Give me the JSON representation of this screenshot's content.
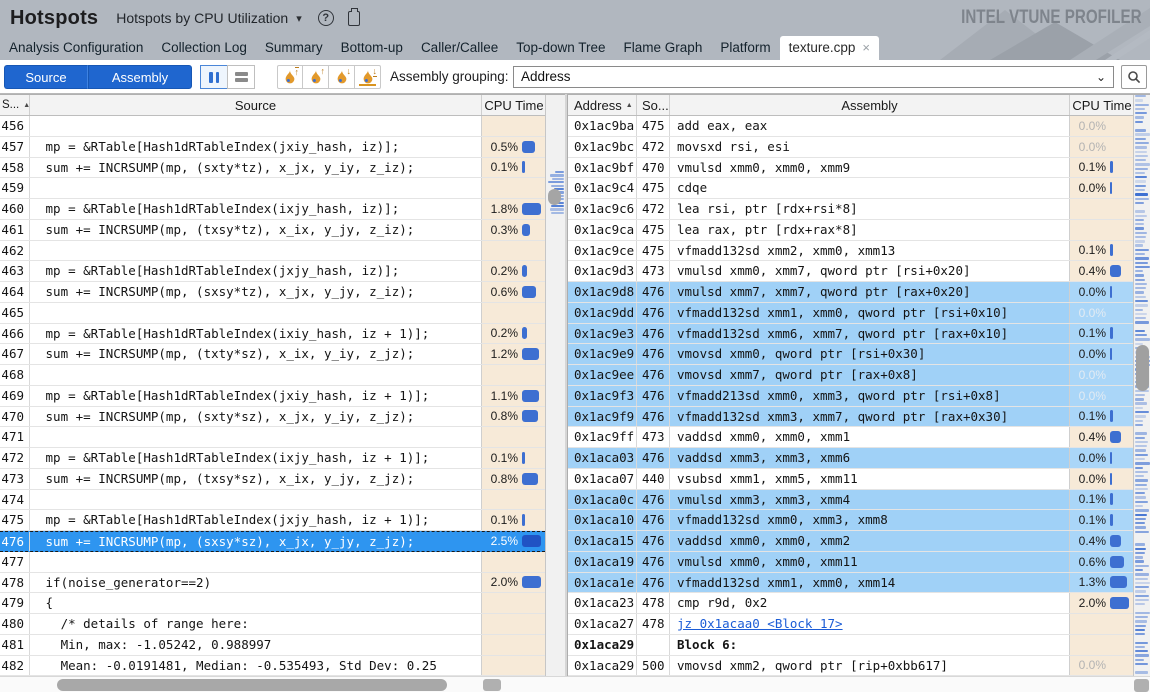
{
  "banner": {
    "title": "Hotspots",
    "subtitle": "Hotspots by CPU Utilization",
    "logo": "INTEL VTUNE PROFILER"
  },
  "tabs": [
    {
      "label": "Analysis Configuration"
    },
    {
      "label": "Collection Log"
    },
    {
      "label": "Summary"
    },
    {
      "label": "Bottom-up"
    },
    {
      "label": "Caller/Callee"
    },
    {
      "label": "Top-down Tree"
    },
    {
      "label": "Flame Graph"
    },
    {
      "label": "Platform"
    },
    {
      "label": "texture.cpp",
      "active": true,
      "closable": true
    }
  ],
  "toolbar": {
    "source_label": "Source",
    "assembly_label": "Assembly",
    "grouping_label": "Assembly grouping:",
    "grouping_value": "Address",
    "flame_buttons": [
      {
        "arrow": "↑",
        "bar": "top"
      },
      {
        "arrow": "↑",
        "bar": "none"
      },
      {
        "arrow": "↓",
        "bar": "none"
      },
      {
        "arrow": "↓",
        "bar": "bottom"
      }
    ]
  },
  "icons": {
    "dropdown_caret": "▾",
    "sort_asc": "▲",
    "close_x": "×",
    "help": "?"
  },
  "colors": {
    "accent_blue": "#1f66cf",
    "selection_blue": "#2e95f0",
    "asm_highlight": "#a0d1f7",
    "cpu_cell_bg": "#f7ead8",
    "cpu_bar_blue": "#3d6fd1",
    "flame_orange": "#e2992b",
    "banner_gray": "#b1b7bf"
  },
  "source_panel": {
    "columns": [
      "S...",
      "Source",
      "CPU Time"
    ],
    "rows": [
      {
        "n": 456,
        "code": "",
        "cpu": ""
      },
      {
        "n": 457,
        "code": " mp = &RTable[Hash1dRTableIndex(jxiy_hash, iz)];",
        "cpu": "0.5%",
        "pct": 0.5
      },
      {
        "n": 458,
        "code": " sum += INCRSUMP(mp, (sxty*tz), x_jx, y_iy, z_iz);",
        "cpu": "0.1%",
        "pct": 0.1
      },
      {
        "n": 459,
        "code": "",
        "cpu": ""
      },
      {
        "n": 460,
        "code": " mp = &RTable[Hash1dRTableIndex(ixjy_hash, iz)];",
        "cpu": "1.8%",
        "pct": 1.8
      },
      {
        "n": 461,
        "code": " sum += INCRSUMP(mp, (txsy*tz), x_ix, y_jy, z_iz);",
        "cpu": "0.3%",
        "pct": 0.3
      },
      {
        "n": 462,
        "code": "",
        "cpu": ""
      },
      {
        "n": 463,
        "code": " mp = &RTable[Hash1dRTableIndex(jxjy_hash, iz)];",
        "cpu": "0.2%",
        "pct": 0.2
      },
      {
        "n": 464,
        "code": " sum += INCRSUMP(mp, (sxsy*tz), x_jx, y_jy, z_iz);",
        "cpu": "0.6%",
        "pct": 0.6
      },
      {
        "n": 465,
        "code": "",
        "cpu": ""
      },
      {
        "n": 466,
        "code": " mp = &RTable[Hash1dRTableIndex(ixiy_hash, iz + 1)];",
        "cpu": "0.2%",
        "pct": 0.2
      },
      {
        "n": 467,
        "code": " sum += INCRSUMP(mp, (txty*sz), x_ix, y_iy, z_jz);",
        "cpu": "1.2%",
        "pct": 1.2
      },
      {
        "n": 468,
        "code": "",
        "cpu": ""
      },
      {
        "n": 469,
        "code": " mp = &RTable[Hash1dRTableIndex(jxiy_hash, iz + 1)];",
        "cpu": "1.1%",
        "pct": 1.1
      },
      {
        "n": 470,
        "code": " sum += INCRSUMP(mp, (sxty*sz), x_jx, y_iy, z_jz);",
        "cpu": "0.8%",
        "pct": 0.8
      },
      {
        "n": 471,
        "code": "",
        "cpu": ""
      },
      {
        "n": 472,
        "code": " mp = &RTable[Hash1dRTableIndex(ixjy_hash, iz + 1)];",
        "cpu": "0.1%",
        "pct": 0.1
      },
      {
        "n": 473,
        "code": " sum += INCRSUMP(mp, (txsy*sz), x_ix, y_jy, z_jz);",
        "cpu": "0.8%",
        "pct": 0.8
      },
      {
        "n": 474,
        "code": "",
        "cpu": ""
      },
      {
        "n": 475,
        "code": " mp = &RTable[Hash1dRTableIndex(jxjy_hash, iz + 1)];",
        "cpu": "0.1%",
        "pct": 0.1
      },
      {
        "n": 476,
        "code": " sum += INCRSUMP(mp, (sxsy*sz), x_jx, y_jy, z_jz);",
        "cpu": "2.5%",
        "pct": 2.5,
        "selected": true
      },
      {
        "n": 477,
        "code": "",
        "cpu": ""
      },
      {
        "n": 478,
        "code": " if(noise_generator==2)",
        "cpu": "2.0%",
        "pct": 2.0
      },
      {
        "n": 479,
        "code": " {",
        "cpu": ""
      },
      {
        "n": 480,
        "code": "   /* details of range here:",
        "cpu": ""
      },
      {
        "n": 481,
        "code": "   Min, max: -1.05242, 0.988997",
        "cpu": ""
      },
      {
        "n": 482,
        "code": "   Mean: -0.0191481, Median: -0.535493, Std Dev: 0.25",
        "cpu": ""
      }
    ]
  },
  "assembly_panel": {
    "columns": [
      "Address",
      "So...",
      "Assembly",
      "CPU Time"
    ],
    "rows": [
      {
        "addr": "0x1ac9ba",
        "line": "475",
        "text": "add eax, eax",
        "cpu": "0.0%",
        "gray": true
      },
      {
        "addr": "0x1ac9bc",
        "line": "472",
        "text": "movsxd rsi, esi",
        "cpu": "0.0%",
        "gray": true
      },
      {
        "addr": "0x1ac9bf",
        "line": "470",
        "text": "vmulsd xmm0, xmm0, xmm9",
        "cpu": "0.1%",
        "pct": 0.1
      },
      {
        "addr": "0x1ac9c4",
        "line": "475",
        "text": "cdqe",
        "cpu": "0.0%",
        "pct": 0
      },
      {
        "addr": "0x1ac9c6",
        "line": "472",
        "text": "lea rsi, ptr [rdx+rsi*8]",
        "cpu": ""
      },
      {
        "addr": "0x1ac9ca",
        "line": "475",
        "text": "lea rax, ptr [rdx+rax*8]",
        "cpu": ""
      },
      {
        "addr": "0x1ac9ce",
        "line": "475",
        "text": "vfmadd132sd xmm2, xmm0, xmm13",
        "cpu": "0.1%",
        "pct": 0.1
      },
      {
        "addr": "0x1ac9d3",
        "line": "473",
        "text": "vmulsd xmm0, xmm7, qword ptr [rsi+0x20]",
        "cpu": "0.4%",
        "pct": 0.4
      },
      {
        "addr": "0x1ac9d8",
        "line": "476",
        "text": "vmulsd xmm7, xmm7, qword ptr [rax+0x20]",
        "cpu": "0.0%",
        "pct": 0,
        "hl": true
      },
      {
        "addr": "0x1ac9dd",
        "line": "476",
        "text": "vfmadd132sd xmm1, xmm0, qword ptr [rsi+0x10]",
        "cpu": "0.0%",
        "gray": true,
        "hl": true
      },
      {
        "addr": "0x1ac9e3",
        "line": "476",
        "text": "vfmadd132sd xmm6, xmm7, qword ptr [rax+0x10]",
        "cpu": "0.1%",
        "pct": 0.1,
        "hl": true
      },
      {
        "addr": "0x1ac9e9",
        "line": "476",
        "text": "vmovsd xmm0, qword ptr [rsi+0x30]",
        "cpu": "0.0%",
        "pct": 0,
        "hl": true
      },
      {
        "addr": "0x1ac9ee",
        "line": "476",
        "text": "vmovsd xmm7, qword ptr [rax+0x8]",
        "cpu": "0.0%",
        "gray": true,
        "hl": true
      },
      {
        "addr": "0x1ac9f3",
        "line": "476",
        "text": "vfmadd213sd xmm0, xmm3, qword ptr [rsi+0x8]",
        "cpu": "0.0%",
        "gray": true,
        "hl": true
      },
      {
        "addr": "0x1ac9f9",
        "line": "476",
        "text": "vfmadd132sd xmm3, xmm7, qword ptr [rax+0x30]",
        "cpu": "0.1%",
        "pct": 0.1,
        "hl": true
      },
      {
        "addr": "0x1ac9ff",
        "line": "473",
        "text": "vaddsd xmm0, xmm0, xmm1",
        "cpu": "0.4%",
        "pct": 0.4
      },
      {
        "addr": "0x1aca03",
        "line": "476",
        "text": "vaddsd xmm3, xmm3, xmm6",
        "cpu": "0.0%",
        "pct": 0,
        "hl": true
      },
      {
        "addr": "0x1aca07",
        "line": "440",
        "text": "vsubsd xmm1, xmm5, xmm11",
        "cpu": "0.0%",
        "pct": 0
      },
      {
        "addr": "0x1aca0c",
        "line": "476",
        "text": "vmulsd xmm3, xmm3, xmm4",
        "cpu": "0.1%",
        "pct": 0.1,
        "hl": true
      },
      {
        "addr": "0x1aca10",
        "line": "476",
        "text": "vfmadd132sd xmm0, xmm3, xmm8",
        "cpu": "0.1%",
        "pct": 0.1,
        "hl": true
      },
      {
        "addr": "0x1aca15",
        "line": "476",
        "text": "vaddsd xmm0, xmm0, xmm2",
        "cpu": "0.4%",
        "pct": 0.4,
        "hl": true
      },
      {
        "addr": "0x1aca19",
        "line": "476",
        "text": "vmulsd xmm0, xmm0, xmm11",
        "cpu": "0.6%",
        "pct": 0.6,
        "hl": true
      },
      {
        "addr": "0x1aca1e",
        "line": "476",
        "text": "vfmadd132sd xmm1, xmm0, xmm14",
        "cpu": "1.3%",
        "pct": 1.3,
        "hl": true
      },
      {
        "addr": "0x1aca23",
        "line": "478",
        "text": "cmp r9d, 0x2",
        "cpu": "2.0%",
        "pct": 2.0
      },
      {
        "addr": "0x1aca27",
        "line": "478",
        "text": "jz 0x1acaa0 <Block 17>",
        "cpu": "",
        "link": true
      },
      {
        "addr": "0x1aca29",
        "line": "",
        "text": "Block 6:",
        "cpu": "",
        "bold": true
      },
      {
        "addr": "0x1aca29",
        "line": "500",
        "text": "vmovsd xmm2, qword ptr [rip+0xbb617]",
        "cpu": "0.0%",
        "gray": true
      }
    ]
  }
}
